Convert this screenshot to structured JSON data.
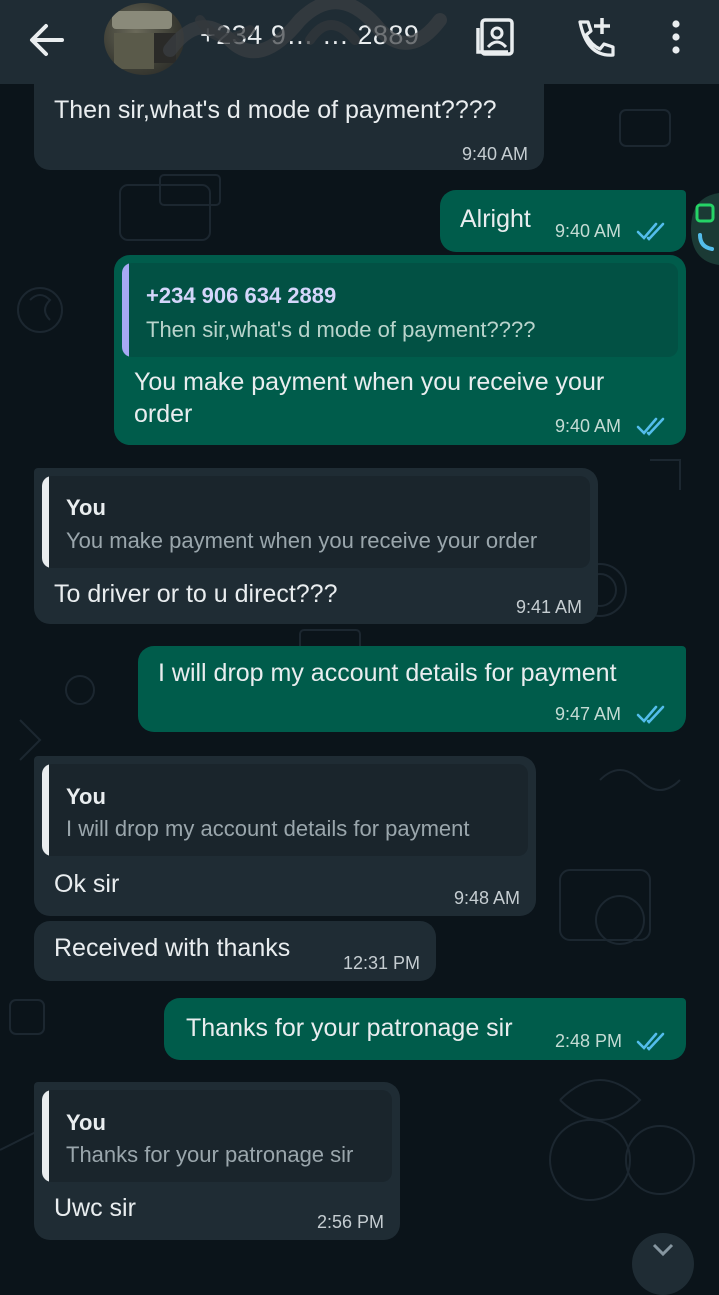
{
  "header": {
    "contact_name": "+234 9… …  2889",
    "back_icon": "arrow-left-icon",
    "icons": [
      "contact-card-icon",
      "add-call-icon",
      "more-vert-icon"
    ]
  },
  "colors": {
    "incoming": "#1f2c34",
    "outgoing": "#005c4b",
    "read_ticks": "#53bdeb",
    "quote_contact": "#a7a9f4",
    "quote_you": "#e9edef"
  },
  "messages": [
    {
      "dir": "in",
      "text": "Then sir,what's d mode of payment????",
      "time": "9:40 AM"
    },
    {
      "dir": "out",
      "text": "Alright",
      "time": "9:40 AM",
      "status": "read"
    },
    {
      "dir": "out",
      "quote_name": "+234 906 634 2889",
      "quote_text": "Then sir,what's d mode of payment????",
      "text_line1": "You make payment when you receive your",
      "text_line2": "order",
      "time": "9:40 AM",
      "status": "read"
    },
    {
      "dir": "in",
      "quote_name": "You",
      "quote_text": "You make payment when you receive your order",
      "text": "To driver or to u direct???",
      "time": "9:41 AM"
    },
    {
      "dir": "out",
      "text": "I will drop my account details for payment",
      "time": "9:47 AM",
      "status": "read"
    },
    {
      "dir": "in",
      "quote_name": "You",
      "quote_text": "I will drop my account details for payment",
      "text": "Ok sir",
      "time": "9:48 AM"
    },
    {
      "dir": "in",
      "text": "Received with thanks",
      "time": "12:31 PM"
    },
    {
      "dir": "out",
      "text": "Thanks for your patronage sir",
      "time": "2:48 PM",
      "status": "read"
    },
    {
      "dir": "in",
      "quote_name": "You",
      "quote_text": "Thanks for your patronage sir",
      "text": "Uwc sir",
      "time": "2:56 PM"
    }
  ]
}
